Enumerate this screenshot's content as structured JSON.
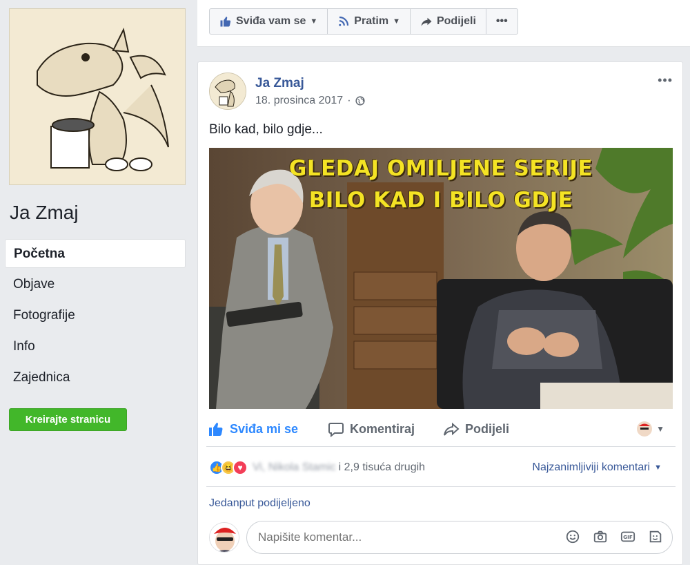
{
  "sidebar": {
    "page_name": "Ja Zmaj",
    "nav": [
      {
        "label": "Početna",
        "active": true
      },
      {
        "label": "Objave",
        "active": false
      },
      {
        "label": "Fotografije",
        "active": false
      },
      {
        "label": "Info",
        "active": false
      },
      {
        "label": "Zajednica",
        "active": false
      }
    ],
    "create_button": "Kreirajte stranicu"
  },
  "topbar": {
    "like": "Sviđa vam se",
    "follow": "Pratim",
    "share": "Podijeli",
    "more": "•••"
  },
  "post": {
    "author": "Ja Zmaj",
    "date": "18. prosinca 2017",
    "text": "Bilo kad, bilo gdje...",
    "image_headline_1": "GLEDAJ OMILJENE SERIJE",
    "image_headline_2": "BILO KAD I BILO GDJE",
    "actions": {
      "like": "Sviđa mi se",
      "comment": "Komentiraj",
      "share": "Podijeli"
    },
    "reactions": {
      "names": "Vi, Nikola Stamic",
      "others": "i 2,9 tisuća drugih",
      "sort": "Najzanimljiviji komentari"
    },
    "shared": "Jedanput podijeljeno",
    "comment_placeholder": "Napišite komentar..."
  },
  "colors": {
    "accent": "#385898",
    "like_blue": "#2d88ff",
    "green": "#42b72a",
    "headline_yellow": "#f4e324"
  }
}
